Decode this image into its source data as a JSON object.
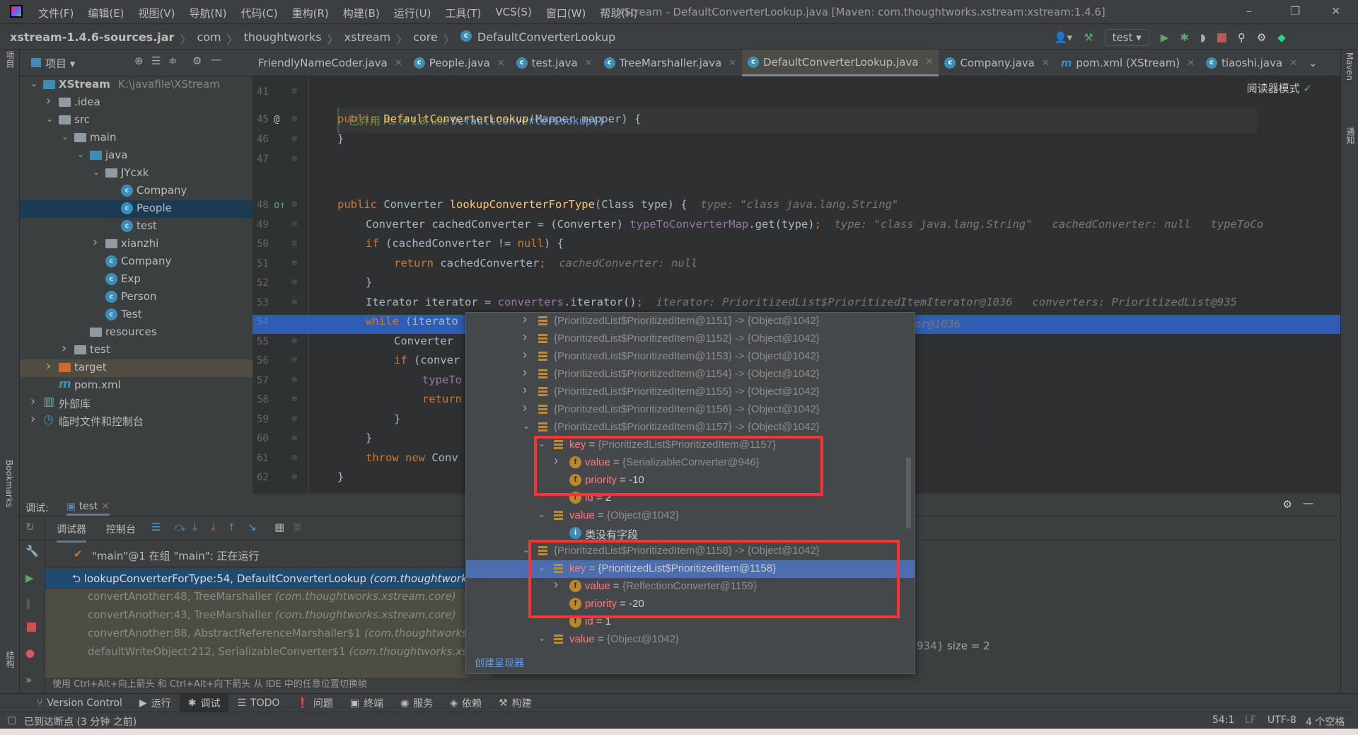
{
  "window": {
    "title": "XStream - DefaultConverterLookup.java [Maven: com.thoughtworks.xstream:xstream:1.4.6]",
    "minimize": "–",
    "restore": "❐",
    "close": "✕"
  },
  "menu": [
    "文件(F)",
    "编辑(E)",
    "视图(V)",
    "导航(N)",
    "代码(C)",
    "重构(R)",
    "构建(B)",
    "运行(U)",
    "工具(T)",
    "VCS(S)",
    "窗口(W)",
    "帮助(H)"
  ],
  "breadcrumb": [
    "xstream-1.4.6-sources.jar",
    "com",
    "thoughtworks",
    "xstream",
    "core",
    "DefaultConverterLookup"
  ],
  "run_config": "test",
  "project_panel": {
    "title": "项目",
    "side_label": "项目"
  },
  "tree": [
    {
      "level": 0,
      "arrow": "down",
      "icon": "module",
      "label": "XStream",
      "path": "K:\\javafile\\XStream"
    },
    {
      "level": 1,
      "arrow": "right",
      "icon": "folder",
      "label": ".idea"
    },
    {
      "level": 1,
      "arrow": "down",
      "icon": "folder",
      "label": "src"
    },
    {
      "level": 2,
      "arrow": "down",
      "icon": "folder",
      "label": "main"
    },
    {
      "level": 3,
      "arrow": "down",
      "icon": "folder-blue",
      "label": "java"
    },
    {
      "level": 4,
      "arrow": "down",
      "icon": "package",
      "label": "JYcxk"
    },
    {
      "level": 5,
      "arrow": "",
      "icon": "class",
      "label": "Company"
    },
    {
      "level": 5,
      "arrow": "",
      "icon": "class",
      "label": "People",
      "selected": true
    },
    {
      "level": 5,
      "arrow": "",
      "icon": "class-run",
      "label": "test"
    },
    {
      "level": 4,
      "arrow": "right",
      "icon": "package",
      "label": "xianzhi"
    },
    {
      "level": 4,
      "arrow": "",
      "icon": "class",
      "label": "Company"
    },
    {
      "level": 4,
      "arrow": "",
      "icon": "class-run",
      "label": "Exp"
    },
    {
      "level": 4,
      "arrow": "",
      "icon": "class",
      "label": "Person"
    },
    {
      "level": 4,
      "arrow": "",
      "icon": "class-run",
      "label": "Test"
    },
    {
      "level": 3,
      "arrow": "",
      "icon": "folder",
      "label": "resources"
    },
    {
      "level": 2,
      "arrow": "right",
      "icon": "folder",
      "label": "test"
    },
    {
      "level": 1,
      "arrow": "right",
      "icon": "folder-orange",
      "label": "target",
      "excluded": true
    },
    {
      "level": 1,
      "arrow": "",
      "icon": "maven",
      "label": "pom.xml"
    },
    {
      "level": 0,
      "arrow": "right",
      "icon": "library",
      "label": "外部库"
    },
    {
      "level": 0,
      "arrow": "right",
      "icon": "scratch",
      "label": "临时文件和控制台"
    }
  ],
  "tabs": [
    {
      "label": "FriendlyNameCoder.java",
      "icon": ""
    },
    {
      "label": "People.java",
      "icon": "class"
    },
    {
      "label": "test.java",
      "icon": "class"
    },
    {
      "label": "TreeMarshaller.java",
      "icon": "class"
    },
    {
      "label": "DefaultConverterLookup.java",
      "icon": "class",
      "active": true
    },
    {
      "label": "Company.java",
      "icon": "class"
    },
    {
      "label": "pom.xml (XStream)",
      "icon": "maven"
    },
    {
      "label": "tiaoshi.java",
      "icon": "class"
    }
  ],
  "editor": {
    "reader_mode": "阅读器模式",
    "doc": {
      "prefix": "已弃用 As of 1.3, use ",
      "link": "DefaultConverterLookup()"
    },
    "lines": [
      {
        "n": "41",
        "indent": 0,
        "tokens": []
      },
      {
        "n": "45",
        "indent": 0,
        "mark": "@",
        "tokens": [
          [
            "kw",
            "public "
          ],
          [
            "fn",
            "DefaultConverterLookup"
          ],
          [
            "",
            "(Mapper mapper) {"
          ]
        ]
      },
      {
        "n": "46",
        "indent": 0,
        "tokens": [
          [
            "",
            "}"
          ]
        ]
      },
      {
        "n": "47",
        "indent": 0,
        "tokens": []
      },
      {
        "n": "48",
        "indent": 0,
        "mark": "o↑",
        "tokens": [
          [
            "kw",
            "public "
          ],
          [
            "",
            "Converter "
          ],
          [
            "fn",
            "lookupConverterForType"
          ],
          [
            "",
            "(Class type) {  "
          ],
          [
            "hint",
            "type: \"class java.lang.String\""
          ]
        ]
      },
      {
        "n": "49",
        "indent": 1,
        "tokens": [
          [
            "",
            "Converter cachedConverter = (Converter) "
          ],
          [
            "fd",
            "typeToConverterMap"
          ],
          [
            "",
            ".get(type)"
          ],
          [
            "kw",
            ";  "
          ],
          [
            "hint",
            "type: \"class java.lang.String\"   cachedConverter: null   typeToCo"
          ]
        ]
      },
      {
        "n": "50",
        "indent": 1,
        "tokens": [
          [
            "kw",
            "if "
          ],
          [
            "",
            "(cachedConverter != "
          ],
          [
            "kw",
            "null"
          ],
          [
            "",
            ") {"
          ]
        ]
      },
      {
        "n": "51",
        "indent": 2,
        "tokens": [
          [
            "kw",
            "return "
          ],
          [
            "",
            "cachedConverter"
          ],
          [
            "kw",
            ";  "
          ],
          [
            "hint",
            "cachedConverter: null"
          ]
        ]
      },
      {
        "n": "52",
        "indent": 1,
        "tokens": [
          [
            "",
            "}"
          ]
        ]
      },
      {
        "n": "53",
        "indent": 1,
        "tokens": [
          [
            "",
            "Iterator iterator = "
          ],
          [
            "fd",
            "converters"
          ],
          [
            "",
            ".iterator()"
          ],
          [
            "kw",
            ";  "
          ],
          [
            "hint",
            "iterator: PrioritizedList$PrioritizedItemIterator@1036   converters: PrioritizedList@935"
          ]
        ]
      },
      {
        "n": "54",
        "indent": 1,
        "tokens": [
          [
            "kw",
            "while "
          ],
          [
            "",
            "(iterato"
          ]
        ]
      },
      {
        "n": "55",
        "indent": 2,
        "tokens": [
          [
            "",
            "Converter"
          ]
        ]
      },
      {
        "n": "56",
        "indent": 2,
        "tokens": [
          [
            "kw",
            "if "
          ],
          [
            "",
            "(conver"
          ]
        ]
      },
      {
        "n": "57",
        "indent": 3,
        "tokens": [
          [
            "fd",
            "typeTo"
          ]
        ]
      },
      {
        "n": "58",
        "indent": 3,
        "tokens": [
          [
            "kw",
            "return"
          ]
        ]
      },
      {
        "n": "59",
        "indent": 2,
        "tokens": [
          [
            "",
            "}"
          ]
        ]
      },
      {
        "n": "60",
        "indent": 1,
        "tokens": [
          [
            "",
            "}"
          ]
        ]
      },
      {
        "n": "61",
        "indent": 1,
        "tokens": [
          [
            "kw",
            "throw new "
          ],
          [
            "",
            "Conv"
          ]
        ]
      },
      {
        "n": "62",
        "indent": 0,
        "tokens": [
          [
            "",
            "}"
          ]
        ]
      }
    ],
    "line54_tail": "or@1036"
  },
  "debug": {
    "label": "调试:",
    "session_tab": "test",
    "tabs": [
      "调试器",
      "控制台"
    ],
    "thread": "\"main\"@1 在组 \"main\": 正在运行",
    "frames": [
      {
        "method": "lookupConverterForType:54, DefaultConverterLookup",
        "pkg": "(com.thoughtworks.xs",
        "selected": true
      },
      {
        "method": "convertAnother:48, TreeMarshaller",
        "pkg": "(com.thoughtworks.xstream.core)"
      },
      {
        "method": "convertAnother:43, TreeMarshaller",
        "pkg": "(com.thoughtworks.xstream.core)"
      },
      {
        "method": "convertAnother:88, AbstractReferenceMarshaller$1",
        "pkg": "(com.thoughtworks.xstre"
      },
      {
        "method": "defaultWriteObject:212, SerializableConverter$1",
        "pkg": "(com.thoughtworks.xstream"
      }
    ],
    "hint": "使用 Ctrl+Alt+向上箭头 和 Ctrl+Alt+向下箭头 从 IDE 中的任意位置切换帧",
    "behind_value": "934}",
    "behind_size": "size = 2"
  },
  "popup": {
    "rows": [
      {
        "lv": 0,
        "arrow": "right",
        "icon": "list",
        "name": "",
        "value": "{PrioritizedList$PrioritizedItem@1151} -> {Object@1042}",
        "grey": true
      },
      {
        "lv": 0,
        "arrow": "right",
        "icon": "list",
        "name": "",
        "value": "{PrioritizedList$PrioritizedItem@1152} -> {Object@1042}",
        "grey": true
      },
      {
        "lv": 0,
        "arrow": "right",
        "icon": "list",
        "name": "",
        "value": "{PrioritizedList$PrioritizedItem@1153} -> {Object@1042}",
        "grey": true
      },
      {
        "lv": 0,
        "arrow": "right",
        "icon": "list",
        "name": "",
        "value": "{PrioritizedList$PrioritizedItem@1154} -> {Object@1042}",
        "grey": true
      },
      {
        "lv": 0,
        "arrow": "right",
        "icon": "list",
        "name": "",
        "value": "{PrioritizedList$PrioritizedItem@1155} -> {Object@1042}",
        "grey": true
      },
      {
        "lv": 0,
        "arrow": "right",
        "icon": "list",
        "name": "",
        "value": "{PrioritizedList$PrioritizedItem@1156} -> {Object@1042}",
        "grey": true
      },
      {
        "lv": 0,
        "arrow": "down",
        "icon": "list",
        "name": "",
        "value": "{PrioritizedList$PrioritizedItem@1157} -> {Object@1042}",
        "grey": true
      },
      {
        "lv": 1,
        "arrow": "down",
        "icon": "list",
        "name": "key",
        "value": "{PrioritizedList$PrioritizedItem@1157}",
        "grey": true
      },
      {
        "lv": 2,
        "arrow": "right",
        "icon": "field",
        "name": "value",
        "value": "{SerializableConverter@946}",
        "grey": true
      },
      {
        "lv": 2,
        "arrow": "",
        "icon": "field",
        "name": "priority",
        "value": "-10"
      },
      {
        "lv": 2,
        "arrow": "",
        "icon": "field",
        "name": "id",
        "value": "2"
      },
      {
        "lv": 1,
        "arrow": "down",
        "icon": "list",
        "name": "value",
        "value": "{Object@1042}",
        "grey": true
      },
      {
        "lv": 2,
        "arrow": "",
        "icon": "info",
        "name": "",
        "value": "类没有字段"
      },
      {
        "lv": 0,
        "arrow": "down",
        "icon": "list",
        "name": "",
        "value": "{PrioritizedList$PrioritizedItem@1158} -> {Object@1042}",
        "grey": true
      },
      {
        "lv": 1,
        "arrow": "down",
        "icon": "list",
        "name": "key",
        "value": "{PrioritizedList$PrioritizedItem@1158}",
        "selected": true
      },
      {
        "lv": 2,
        "arrow": "right",
        "icon": "field",
        "name": "value",
        "value": "{ReflectionConverter@1159}",
        "grey": true
      },
      {
        "lv": 2,
        "arrow": "",
        "icon": "field",
        "name": "priority",
        "value": "-20"
      },
      {
        "lv": 2,
        "arrow": "",
        "icon": "field",
        "name": "id",
        "value": "1"
      },
      {
        "lv": 1,
        "arrow": "down",
        "icon": "list",
        "name": "value",
        "value": "{Object@1042}",
        "grey": true
      }
    ],
    "create_renderer": "创建呈现器",
    "highlight_color": "#ff3333"
  },
  "bottom_tools": [
    {
      "label": "Version Control",
      "icon": "vcs-icon"
    },
    {
      "label": "运行",
      "icon": "run-icon"
    },
    {
      "label": "调试",
      "icon": "debug-icon",
      "active": true
    },
    {
      "label": "TODO",
      "icon": "todo-icon"
    },
    {
      "label": "问题",
      "icon": "problems-icon"
    },
    {
      "label": "终端",
      "icon": "terminal-icon"
    },
    {
      "label": "服务",
      "icon": "services-icon"
    },
    {
      "label": "依赖",
      "icon": "dependencies-icon"
    },
    {
      "label": "构建",
      "icon": "build-icon"
    }
  ],
  "status": {
    "message": "已到达断点 (3 分钟 之前)",
    "position": "54:1",
    "line_sep": "LF",
    "encoding": "UTF-8",
    "indent": "4 个空格"
  },
  "side": {
    "bookmarks": "Bookmarks",
    "structure": "结构",
    "maven": "Maven",
    "notifications": "通知"
  }
}
